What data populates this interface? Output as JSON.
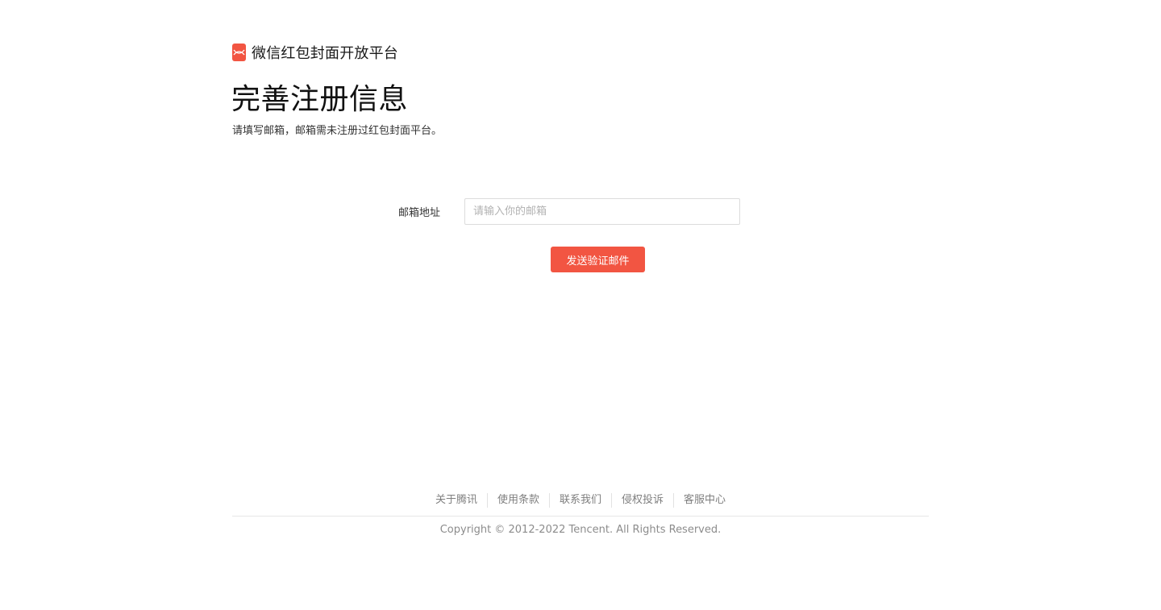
{
  "brand": {
    "name": "微信红包封面开放平台",
    "logo_icon": "red-envelope-icon",
    "accent_color": "#f25542"
  },
  "page": {
    "title": "完善注册信息",
    "subtitle": "请填写邮箱，邮箱需未注册过红包封面平台。"
  },
  "form": {
    "email_label": "邮箱地址",
    "email_value": "",
    "email_placeholder": "请输入你的邮箱",
    "submit_label": "发送验证邮件"
  },
  "footer": {
    "links": [
      "关于腾讯",
      "使用条款",
      "联系我们",
      "侵权投诉",
      "客服中心"
    ],
    "copyright": "Copyright © 2012-2022 Tencent. All Rights Reserved."
  }
}
